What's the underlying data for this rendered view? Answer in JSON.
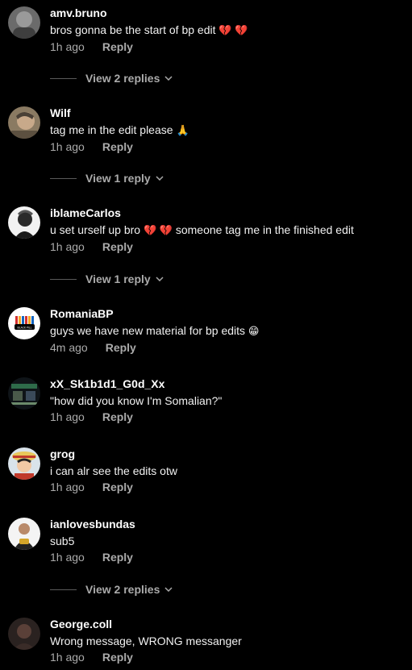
{
  "comments": [
    {
      "username": "amv.bruno",
      "text": "bros gonna be the start of bp edit",
      "text_suffix": "💔 💔",
      "time": "1h ago",
      "reply_label": "Reply",
      "replies_label": "View 2 replies"
    },
    {
      "username": "Wilf",
      "text": "tag me in the edit please",
      "text_suffix": "🙏",
      "time": "1h ago",
      "reply_label": "Reply",
      "replies_label": "View 1 reply"
    },
    {
      "username": "iblameCarlos",
      "text": "u set urself up bro",
      "text_mid": "💔 💔",
      "text_after": "someone tag me in the finished edit",
      "time": "1h ago",
      "reply_label": "Reply",
      "replies_label": "View 1 reply"
    },
    {
      "username": "RomaniaBP",
      "text": "guys we have new material for bp edits",
      "text_suffix": "😁",
      "time": "4m ago",
      "reply_label": "Reply",
      "avatar_text": "BLACK PILL"
    },
    {
      "username": "xX_Sk1b1d1_G0d_Xx",
      "text": "\"how did you know I'm Somalian?\"",
      "time": "1h ago",
      "reply_label": "Reply"
    },
    {
      "username": "grog",
      "text": "i can alr see the edits otw",
      "time": "1h ago",
      "reply_label": "Reply"
    },
    {
      "username": "ianlovesbundas",
      "text": "sub5",
      "time": "1h ago",
      "reply_label": "Reply",
      "replies_label": "View 2 replies"
    },
    {
      "username": "George.coll",
      "text": "Wrong message, WRONG messanger",
      "time": "1h ago",
      "reply_label": "Reply"
    }
  ],
  "colors": {
    "background": "#000000",
    "text": "#ffffff",
    "muted": "#aaaaaa",
    "heart": "#e0245e"
  },
  "icons": {
    "chevron": "chevron-down-icon"
  }
}
